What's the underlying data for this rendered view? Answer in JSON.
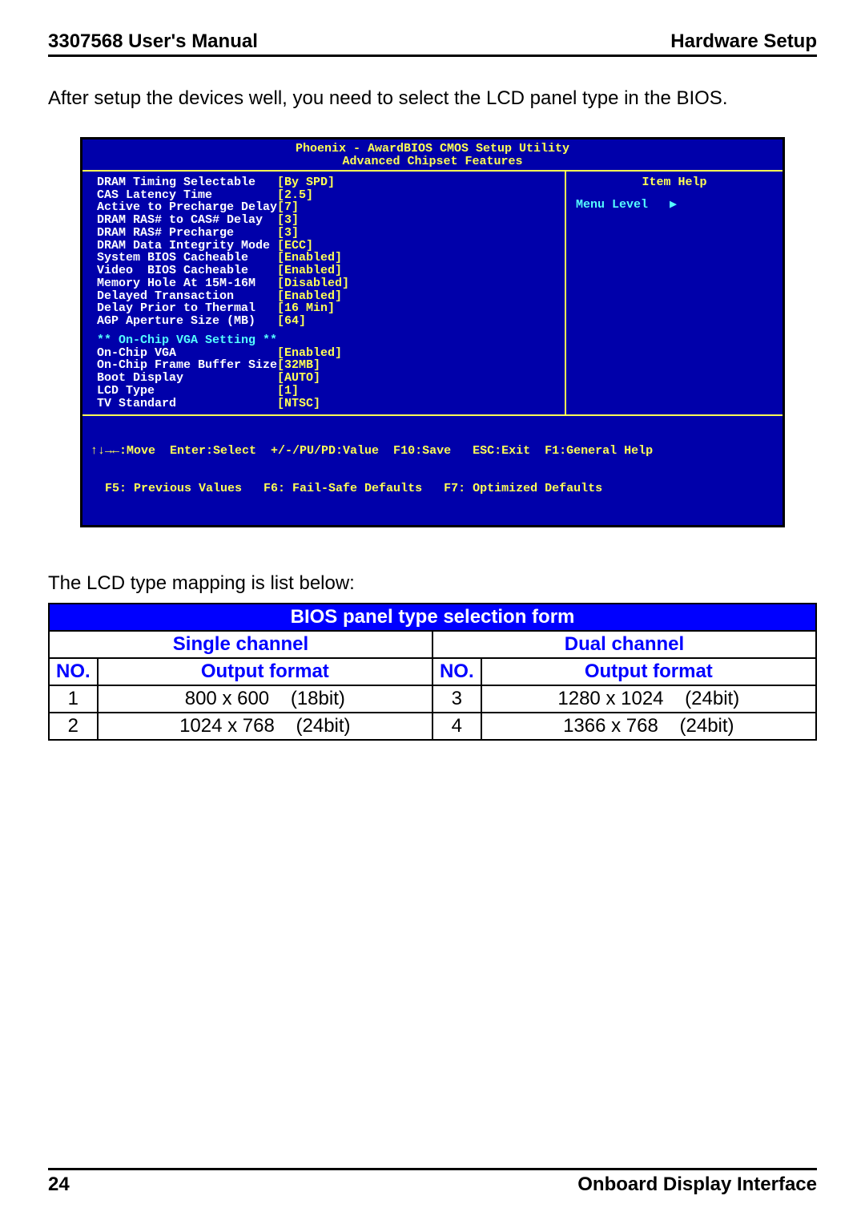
{
  "header": {
    "left": "3307568 User's Manual",
    "right": "Hardware Setup"
  },
  "intro": "After setup the devices well, you need to select the LCD panel type in the BIOS.",
  "bios": {
    "title": "Phoenix - AwardBIOS CMOS Setup Utility",
    "subtitle": "Advanced Chipset Features",
    "rows": [
      {
        "label": "DRAM Timing Selectable",
        "value": "[By SPD]"
      },
      {
        "label": "CAS Latency Time",
        "value": "[2.5]"
      },
      {
        "label": "Active to Precharge Delay",
        "value": "[7]"
      },
      {
        "label": "DRAM RAS# to CAS# Delay",
        "value": "[3]"
      },
      {
        "label": "DRAM RAS# Precharge",
        "value": "[3]"
      },
      {
        "label": "DRAM Data Integrity Mode",
        "value": "[ECC]"
      },
      {
        "label": "System BIOS Cacheable",
        "value": "[Enabled]"
      },
      {
        "label": "Video  BIOS Cacheable",
        "value": "[Enabled]"
      },
      {
        "label": "Memory Hole At 15M-16M",
        "value": "[Disabled]"
      },
      {
        "label": "Delayed Transaction",
        "value": "[Enabled]"
      },
      {
        "label": "Delay Prior to Thermal",
        "value": "[16 Min]"
      },
      {
        "label": "AGP Aperture Size (MB)",
        "value": "[64]"
      }
    ],
    "section": "** On-Chip VGA Setting **",
    "rows2": [
      {
        "label": "On-Chip VGA",
        "value": "[Enabled]"
      },
      {
        "label": "On-Chip Frame Buffer Size",
        "value": "[32MB]"
      },
      {
        "label": "Boot Display",
        "value": "[AUTO]"
      },
      {
        "label": "LCD Type",
        "value": "[1]"
      },
      {
        "label": "TV Standard",
        "value": "[NTSC]"
      }
    ],
    "help_title": "Item Help",
    "menu_level": "Menu Level",
    "footer_line1": "↑↓→←:Move  Enter:Select  +/-/PU/PD:Value  F10:Save   ESC:Exit  F1:General Help",
    "footer_line2": "  F5: Previous Values   F6: Fail-Safe Defaults   F7: Optimized Defaults"
  },
  "mapping_intro": "The LCD type mapping is list below:",
  "table": {
    "title": "BIOS panel type selection form",
    "single": "Single channel",
    "dual": "Dual channel",
    "no_hdr": "NO.",
    "fmt_hdr": "Output format",
    "rows": [
      {
        "n1": "1",
        "f1": "800 x 600    (18bit)",
        "n2": "3",
        "f2": "1280 x 1024    (24bit)"
      },
      {
        "n1": "2",
        "f1": "1024 x 768    (24bit)",
        "n2": "4",
        "f2": "1366 x 768    (24bit)"
      }
    ]
  },
  "footer": {
    "page": "24",
    "section": "Onboard  Display  Interface"
  }
}
